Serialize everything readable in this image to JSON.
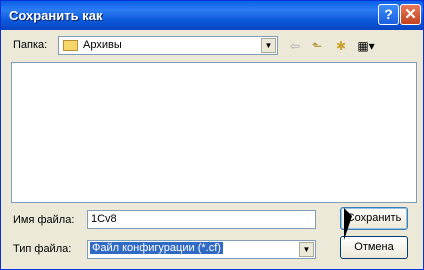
{
  "titlebar": {
    "title": "Сохранить как",
    "help_glyph": "?",
    "close_glyph": "✕"
  },
  "folder": {
    "label": "Папка:",
    "value": "Архивы"
  },
  "toolbar": {
    "back_glyph": "⇦",
    "up_glyph": "⬑",
    "new_glyph": "✱",
    "view_glyph": "▦▾"
  },
  "filename": {
    "label": "Имя файла:",
    "value": "1Cv8"
  },
  "filetype": {
    "label": "Тип файла:",
    "value": "Файл конфигурации (*.cf)"
  },
  "buttons": {
    "save": "Сохранить",
    "cancel": "Отмена"
  }
}
